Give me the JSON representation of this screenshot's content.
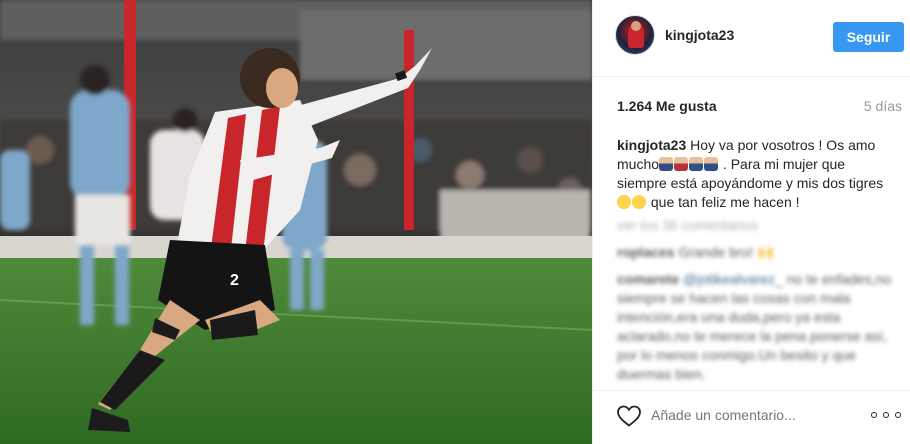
{
  "post": {
    "image_alt": "Footballer celebrating a goal",
    "shirt_number": "2"
  },
  "header": {
    "username": "kingjota23",
    "follow_label": "Seguir",
    "avatar_icon": "profile-avatar"
  },
  "stats": {
    "likes": "1.264 Me gusta",
    "time_ago": "5 días"
  },
  "caption": {
    "username": "kingjota23",
    "text_1": "Hoy va por vosotros ! Os amo mucho",
    "text_2": ". Para mi mujer que siempre está apoyándome y mis dos tigres",
    "text_3": "que tan feliz me hacen !"
  },
  "comments": {
    "load_more": "ver los 36 comentarios",
    "items": [
      {
        "username": "roplaces",
        "text": "Grande bro! 🙌"
      },
      {
        "username": "comarete",
        "mention": "@jotikealvarez_",
        "text": "no te enfades,no siempre se hacen las cosas con mala intención,era una duda,pero ya esta aclarado,no te merece la pena ponerse así, por lo menos conmigo.Un besito y que duermas bien."
      }
    ]
  },
  "footer": {
    "comment_placeholder": "Añade un comentario...",
    "heart_icon": "heart-icon",
    "more_icon": "more-options-icon"
  },
  "colors": {
    "accent": "#3897f0",
    "text": "#262626",
    "muted": "#999999",
    "divider": "#efefef"
  }
}
